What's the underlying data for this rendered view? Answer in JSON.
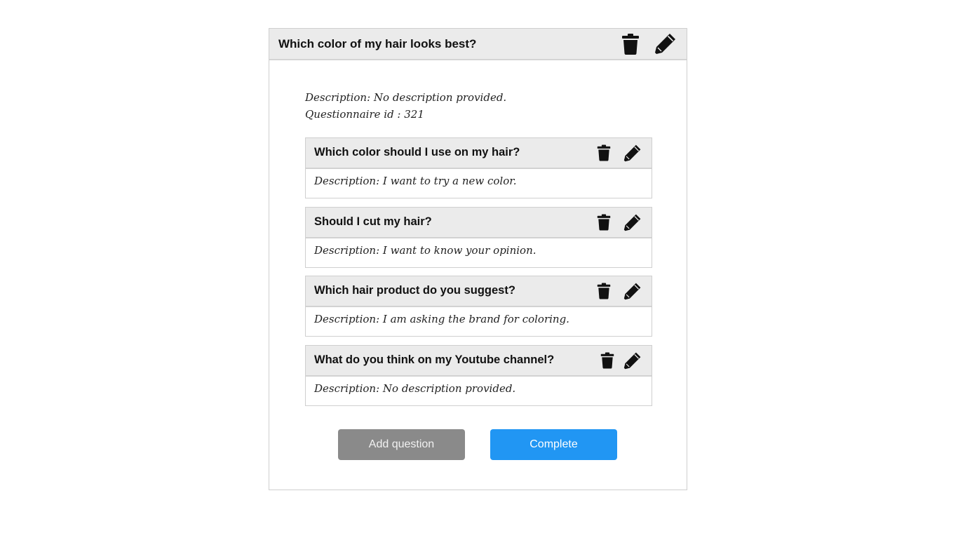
{
  "questionnaire": {
    "title": "Which color of my hair looks best?",
    "description": "Description: No description provided.",
    "id_text": "Questionnaire id : 321"
  },
  "questions": [
    {
      "title": "Which color should I use on my hair?",
      "description": "Description: I want to try a new color."
    },
    {
      "title": "Should I cut my hair?",
      "description": "Description: I want to know your opinion."
    },
    {
      "title": "Which hair product do you suggest?",
      "description": "Description: I am asking the brand for coloring."
    },
    {
      "title": "What do you think on my Youtube channel?",
      "description": "Description: No description provided."
    }
  ],
  "buttons": {
    "add_question": "Add question",
    "complete": "Complete"
  },
  "icons": {
    "delete": "trash-icon",
    "edit": "pencil-icon"
  },
  "colors": {
    "header_bg": "#ebebeb",
    "add_button": "#8a8a8a",
    "complete_button": "#2196f3"
  }
}
